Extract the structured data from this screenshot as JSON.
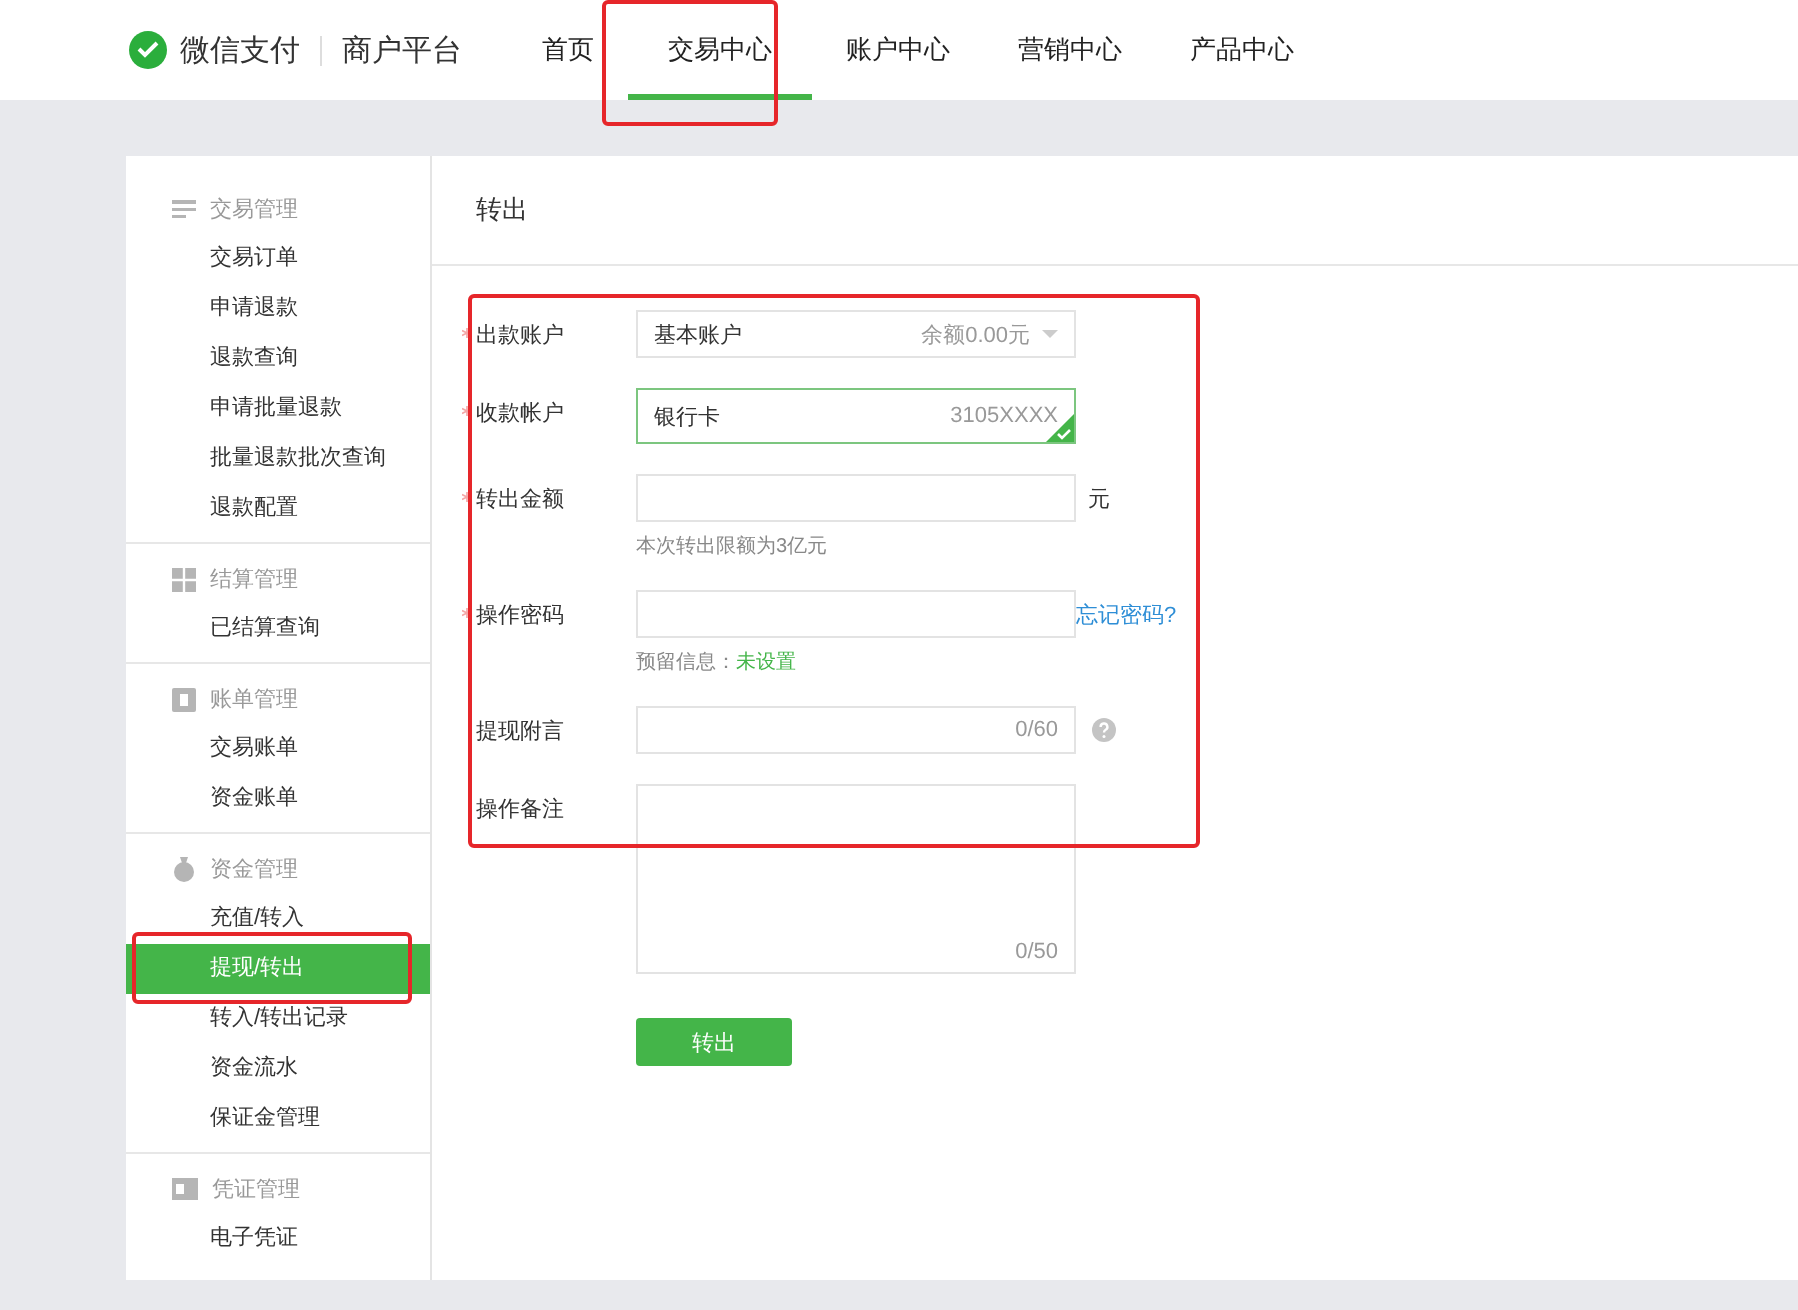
{
  "header": {
    "brand": "微信支付",
    "product": "商户平台",
    "nav": [
      {
        "label": "首页",
        "selected": false
      },
      {
        "label": "交易中心",
        "selected": true
      },
      {
        "label": "账户中心",
        "selected": false
      },
      {
        "label": "营销中心",
        "selected": false
      },
      {
        "label": "产品中心",
        "selected": false
      }
    ]
  },
  "sidebar": {
    "groups": [
      {
        "title": "交易管理",
        "items": [
          {
            "label": "交易订单",
            "selected": false
          },
          {
            "label": "申请退款",
            "selected": false
          },
          {
            "label": "退款查询",
            "selected": false
          },
          {
            "label": "申请批量退款",
            "selected": false
          },
          {
            "label": "批量退款批次查询",
            "selected": false
          },
          {
            "label": "退款配置",
            "selected": false
          }
        ]
      },
      {
        "title": "结算管理",
        "items": [
          {
            "label": "已结算查询",
            "selected": false
          }
        ]
      },
      {
        "title": "账单管理",
        "items": [
          {
            "label": "交易账单",
            "selected": false
          },
          {
            "label": "资金账单",
            "selected": false
          }
        ]
      },
      {
        "title": "资金管理",
        "items": [
          {
            "label": "充值/转入",
            "selected": false
          },
          {
            "label": "提现/转出",
            "selected": true
          },
          {
            "label": "转入/转出记录",
            "selected": false
          },
          {
            "label": "资金流水",
            "selected": false
          },
          {
            "label": "保证金管理",
            "selected": false
          }
        ]
      },
      {
        "title": "凭证管理",
        "items": [
          {
            "label": "电子凭证",
            "selected": false
          }
        ]
      }
    ]
  },
  "page_title": "转出",
  "form": {
    "fields": [
      {
        "kind": "select",
        "label": "出款账户",
        "required": true,
        "value": "基本账户",
        "extra": "余额0.00元"
      },
      {
        "kind": "account",
        "label": "收款帐户",
        "required": true,
        "value": "银行卡",
        "extra": "3105XXXX",
        "verified": true
      },
      {
        "kind": "amount",
        "label": "转出金额",
        "required": true,
        "unit": "元",
        "hint": "本次转出限额为3亿元"
      },
      {
        "kind": "password",
        "label": "操作密码",
        "required": true,
        "link": "忘记密码?",
        "hint": "预留信息：",
        "hint_value": "未设置"
      },
      {
        "kind": "counter",
        "label": "提现附言",
        "required": false,
        "counter": "0/60",
        "help": true
      },
      {
        "kind": "textarea",
        "label": "操作备注",
        "required": false,
        "counter": "0/50"
      }
    ],
    "submit": "转出"
  }
}
